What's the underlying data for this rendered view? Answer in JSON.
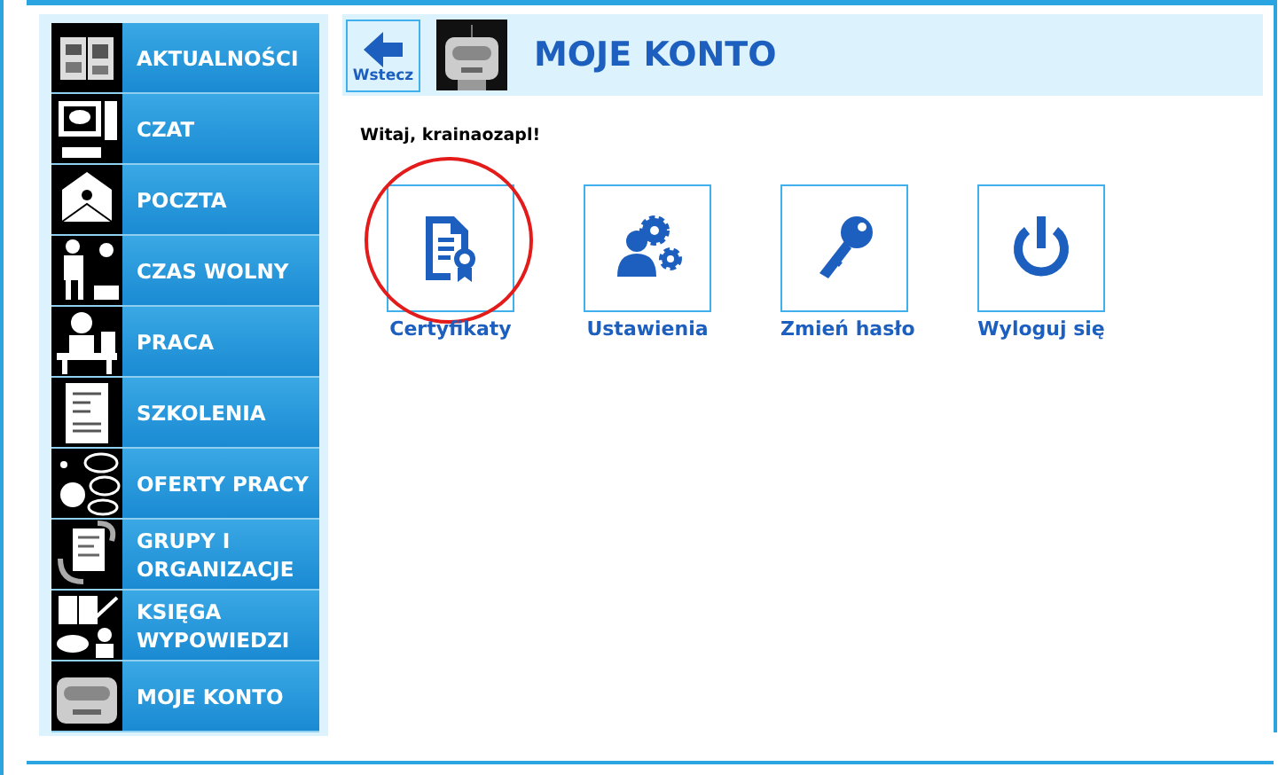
{
  "sidebar": {
    "items": [
      {
        "label": "AKTUALNOŚCI"
      },
      {
        "label": "CZAT"
      },
      {
        "label": "POCZTA"
      },
      {
        "label": "CZAS WOLNY"
      },
      {
        "label": "PRACA"
      },
      {
        "label": "SZKOLENIA"
      },
      {
        "label": "OFERTY PRACY"
      },
      {
        "label": "GRUPY I ORGANIZACJE"
      },
      {
        "label": "KSIĘGA WYPOWIEDZI"
      },
      {
        "label": "MOJE KONTO"
      }
    ]
  },
  "header": {
    "back_label": "Wstecz",
    "title": "MOJE KONTO"
  },
  "greeting": "Witaj, krainaozapl!",
  "tiles": [
    {
      "label": "Certyfikaty",
      "circled": true
    },
    {
      "label": "Ustawienia",
      "circled": false
    },
    {
      "label": "Zmień hasło",
      "circled": false
    },
    {
      "label": "Wyloguj się",
      "circled": false
    }
  ]
}
